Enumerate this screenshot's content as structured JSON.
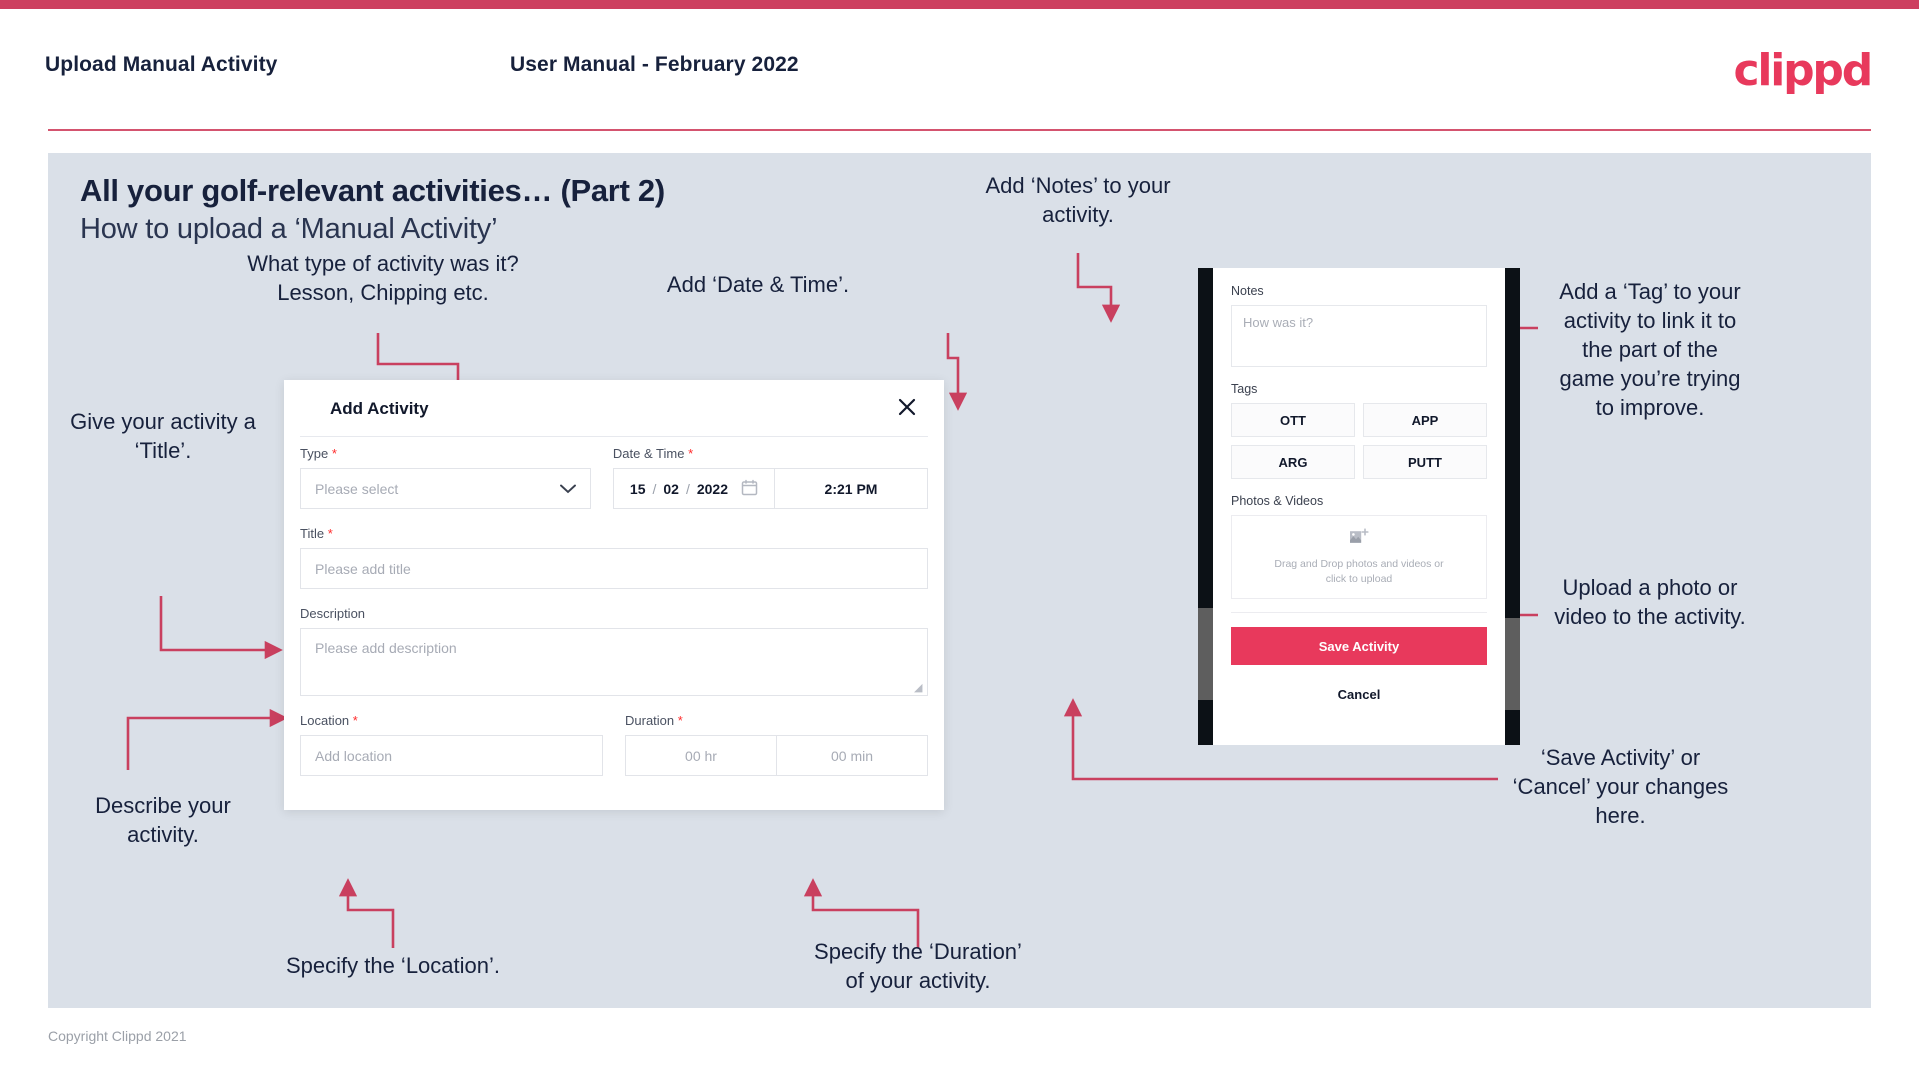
{
  "header": {
    "title": "Upload Manual Activity",
    "subtitle": "User Manual - February 2022",
    "logo": "clippd"
  },
  "slide": {
    "title": "All your golf-relevant activities… (Part 2)",
    "subtitle": "How to upload a ‘Manual Activity’"
  },
  "annotations": {
    "type": "What type of activity was it?\nLesson, Chipping etc.",
    "datetime": "Add ‘Date & Time’.",
    "title": "Give your activity a\n‘Title’.",
    "description": "Describe your\nactivity.",
    "location": "Specify the ‘Location’.",
    "duration": "Specify the ‘Duration’\nof your activity.",
    "notes": "Add ‘Notes’ to your\nactivity.",
    "tags": "Add a ‘Tag’ to your\nactivity to link it to\nthe part of the\ngame you’re trying\nto improve.",
    "photos": "Upload a photo or\nvideo to the activity.",
    "save": "‘Save Activity’ or\n‘Cancel’ your changes\nhere."
  },
  "modal": {
    "title": "Add Activity",
    "close_icon": "close-icon",
    "fields": {
      "type": {
        "label": "Type",
        "required": true,
        "placeholder": "Please select",
        "icon": "chevron-down-icon"
      },
      "datetime": {
        "label": "Date & Time",
        "required": true,
        "day": "15",
        "month": "02",
        "year": "2022",
        "separator": "/",
        "time": "2:21 PM",
        "icon": "calendar-icon"
      },
      "title": {
        "label": "Title",
        "required": true,
        "placeholder": "Please add title"
      },
      "description": {
        "label": "Description",
        "required": false,
        "placeholder": "Please add description"
      },
      "location": {
        "label": "Location",
        "required": true,
        "placeholder": "Add location"
      },
      "duration": {
        "label": "Duration",
        "required": true,
        "hours": "00 hr",
        "minutes": "00 min"
      }
    }
  },
  "phone": {
    "notes": {
      "label": "Notes",
      "placeholder": "How was it?"
    },
    "tags": {
      "label": "Tags",
      "options": [
        "OTT",
        "APP",
        "ARG",
        "PUTT"
      ]
    },
    "photos": {
      "label": "Photos & Videos",
      "dropzone_line1": "Drag and Drop photos and videos or",
      "dropzone_line2": "click to upload",
      "icon": "add-image-icon"
    },
    "save_label": "Save Activity",
    "cancel_label": "Cancel"
  },
  "footer": {
    "copyright": "Copyright Clippd 2021"
  },
  "colors": {
    "accent": "#e8395c",
    "top_bar": "#cd4060",
    "slide_bg": "#dae0e8",
    "text_dark": "#17213c",
    "connector": "#c9405f",
    "required": "#ff2b2b"
  }
}
